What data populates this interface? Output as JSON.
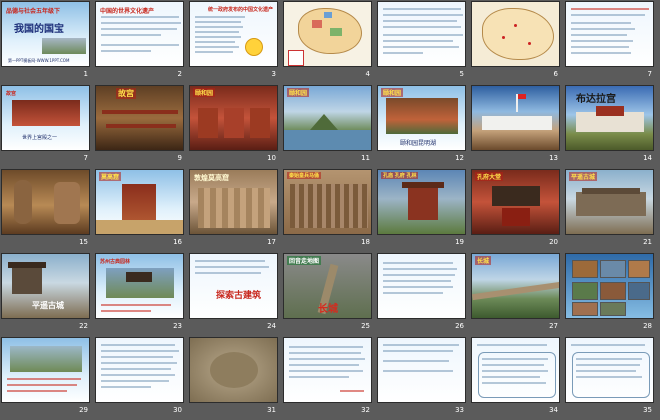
{
  "slides": [
    {
      "num": "1",
      "title": "品德与社会五年级下",
      "subtitle": "我国的国宝",
      "caption": "第一PPT模板网-WWW.1PPT.COM"
    },
    {
      "num": "2",
      "title": "中国的世界文化遗产",
      "caption": ""
    },
    {
      "num": "3",
      "title": "统一政府发布的中国文化遗产",
      "caption": ""
    },
    {
      "num": "4",
      "title": "",
      "caption": ""
    },
    {
      "num": "5",
      "title": "",
      "caption": ""
    },
    {
      "num": "6",
      "title": "",
      "caption": ""
    },
    {
      "num": "7",
      "title": "故宫",
      "caption": "世界上宫殿之一"
    },
    {
      "num": "8",
      "title": "故宫",
      "caption": ""
    },
    {
      "num": "9",
      "title": "",
      "caption": ""
    },
    {
      "num": "10",
      "title": "",
      "caption": "故宫、天坛、颐和园"
    },
    {
      "num": "11",
      "title": "颐和园",
      "caption": ""
    },
    {
      "num": "12",
      "title": "",
      "caption": ""
    },
    {
      "num": "13",
      "title": "",
      "caption": ""
    },
    {
      "num": "14",
      "title": "布达拉宫",
      "caption": ""
    },
    {
      "num": "15",
      "title": "",
      "caption": ""
    },
    {
      "num": "16",
      "title": "莫高窟",
      "caption": ""
    },
    {
      "num": "17",
      "title": "敦煌莫高窟",
      "caption": ""
    },
    {
      "num": "18",
      "title": "秦始皇兵马俑",
      "caption": ""
    },
    {
      "num": "19",
      "title": "孔庙 孔府 孔林",
      "caption": ""
    },
    {
      "num": "20",
      "title": "",
      "caption": ""
    },
    {
      "num": "21",
      "title": "平遥古城",
      "caption": ""
    },
    {
      "num": "22",
      "title": "",
      "caption": "平遥古城"
    },
    {
      "num": "23",
      "title": "苏州古典园林",
      "caption": ""
    },
    {
      "num": "24",
      "title": "",
      "caption": "探索古建筑"
    },
    {
      "num": "25",
      "title": "长城",
      "caption": ""
    },
    {
      "num": "26",
      "title": "",
      "caption": ""
    },
    {
      "num": "27",
      "title": "长城",
      "caption": ""
    },
    {
      "num": "28",
      "title": "",
      "caption": ""
    },
    {
      "num": "29",
      "title": "",
      "caption": ""
    },
    {
      "num": "30",
      "title": "",
      "caption": ""
    },
    {
      "num": "31",
      "title": "",
      "caption": ""
    },
    {
      "num": "32",
      "title": "",
      "caption": ""
    },
    {
      "num": "33",
      "title": "",
      "caption": ""
    },
    {
      "num": "34",
      "title": "",
      "caption": ""
    },
    {
      "num": "35",
      "title": "",
      "caption": ""
    }
  ]
}
